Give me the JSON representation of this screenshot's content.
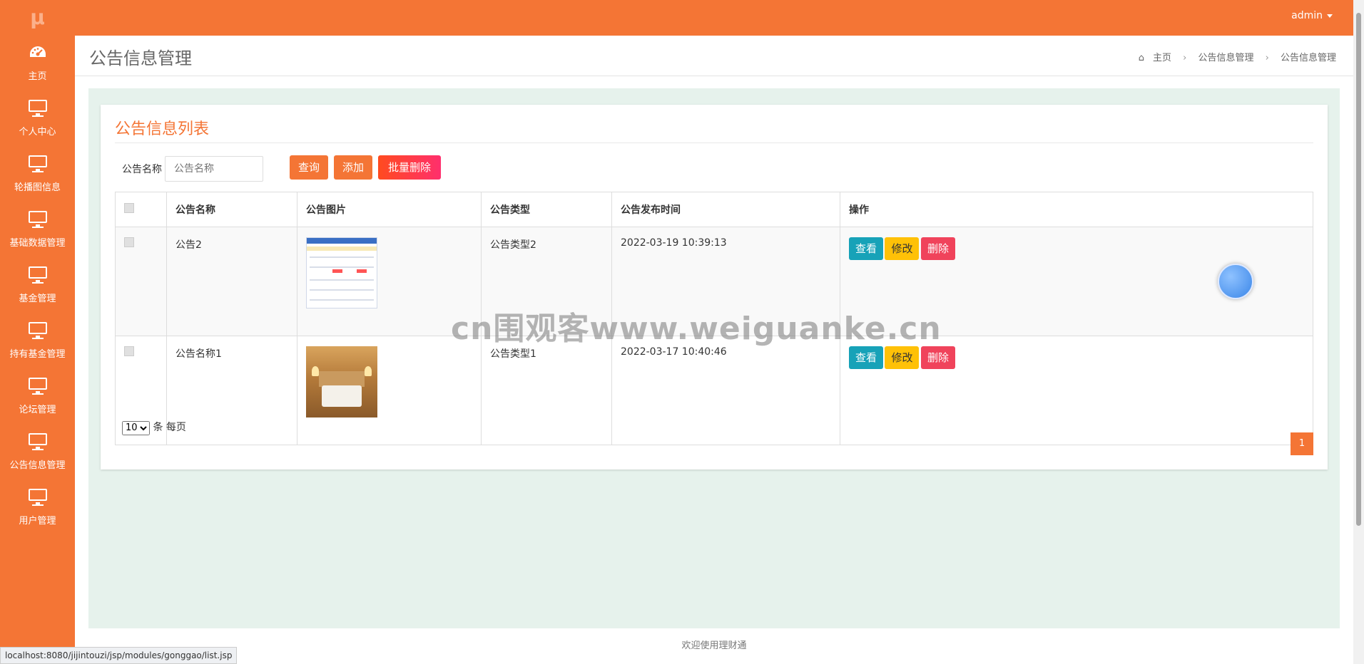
{
  "logo": "μ",
  "user": {
    "name": "admin"
  },
  "sidebar": {
    "items": [
      {
        "label": "主页",
        "icon": "dashboard-icon"
      },
      {
        "label": "个人中心",
        "icon": "monitor-icon"
      },
      {
        "label": "轮播图信息",
        "icon": "monitor-icon"
      },
      {
        "label": "基础数据管理",
        "icon": "monitor-icon"
      },
      {
        "label": "基金管理",
        "icon": "monitor-icon"
      },
      {
        "label": "持有基金管理",
        "icon": "monitor-icon"
      },
      {
        "label": "论坛管理",
        "icon": "monitor-icon"
      },
      {
        "label": "公告信息管理",
        "icon": "monitor-icon"
      },
      {
        "label": "用户管理",
        "icon": "monitor-icon"
      }
    ]
  },
  "header": {
    "title": "公告信息管理",
    "breadcrumb": [
      "主页",
      "公告信息管理",
      "公告信息管理"
    ]
  },
  "card": {
    "title": "公告信息列表",
    "filter_label": "公告名称",
    "filter_placeholder": "公告名称",
    "buttons": {
      "search": "查询",
      "add": "添加",
      "batch_delete": "批量删除"
    }
  },
  "table": {
    "columns": [
      "公告名称",
      "公告图片",
      "公告类型",
      "公告发布时间",
      "操作"
    ],
    "rows": [
      {
        "name": "公告2",
        "type": "公告类型2",
        "time": "2022-03-19 10:39:13",
        "image": "dashboard-screenshot"
      },
      {
        "name": "公告名称1",
        "type": "公告类型1",
        "time": "2022-03-17 10:40:46",
        "image": "hotel-room-photo"
      }
    ],
    "actions": {
      "view": "查看",
      "edit": "修改",
      "delete": "删除"
    }
  },
  "pagination": {
    "page_size": "10",
    "per_page_label": "条 每页",
    "current_page": "1"
  },
  "footer": "欢迎使用理财通",
  "status_url": "localhost:8080/jijintouzi/jsp/modules/gonggao/list.jsp",
  "watermark": "cn围观客www.weiguanke.cn",
  "colors": {
    "primary": "#f47535",
    "view": "#17a2b8",
    "edit": "#ffc107",
    "delete": "#f0435b",
    "content_bg": "#e6f2ec"
  }
}
